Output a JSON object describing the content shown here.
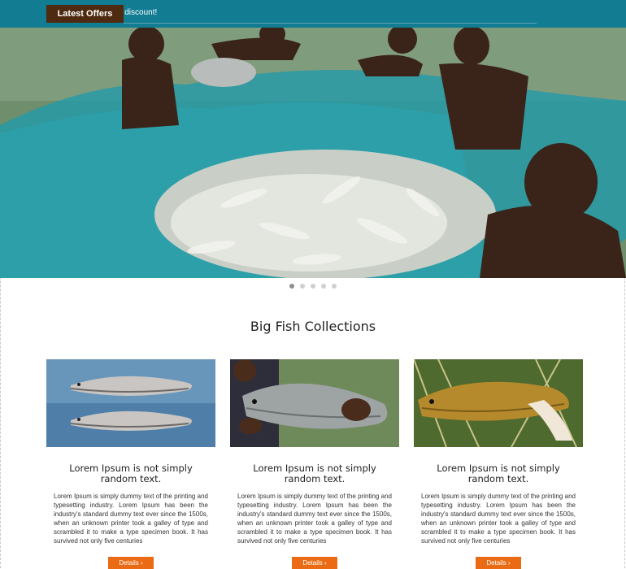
{
  "offers": {
    "badge_label": "Latest Offers",
    "ticker_text": "5% discount!"
  },
  "hero": {
    "slides_count": 5,
    "active_slide": 1
  },
  "section": {
    "title": "Big Fish Collections"
  },
  "products": [
    {
      "title": "Lorem Ipsum is not simply random text.",
      "description": "Lorem Ipsum is simply dummy text of the printing and typesetting industry. Lorem Ipsum has been the industry's standard dummy text ever since the 1500s, when an unknown printer took a galley of type and scrambled it to make a type specimen book. It has survived not only five centuries",
      "button_label": "Details ›"
    },
    {
      "title": "Lorem Ipsum is not simply random text.",
      "description": "Lorem Ipsum is simply dummy text of the printing and typesetting industry. Lorem Ipsum has been the industry's standard dummy text ever since the 1500s, when an unknown printer took a galley of type and scrambled it to make a type specimen book. It has survived not only five centuries",
      "button_label": "Details ›"
    },
    {
      "title": "Lorem Ipsum is not simply random text.",
      "description": "Lorem Ipsum is simply dummy text of the printing and typesetting industry. Lorem Ipsum has been the industry's standard dummy text ever since the 1500s, when an unknown printer took a galley of type and scrambled it to make a type specimen book. It has survived not only five centuries",
      "button_label": "Details ›"
    }
  ],
  "colors": {
    "offers_bar": "#127c93",
    "badge": "#4e2b10",
    "button": "#ea6b14"
  }
}
